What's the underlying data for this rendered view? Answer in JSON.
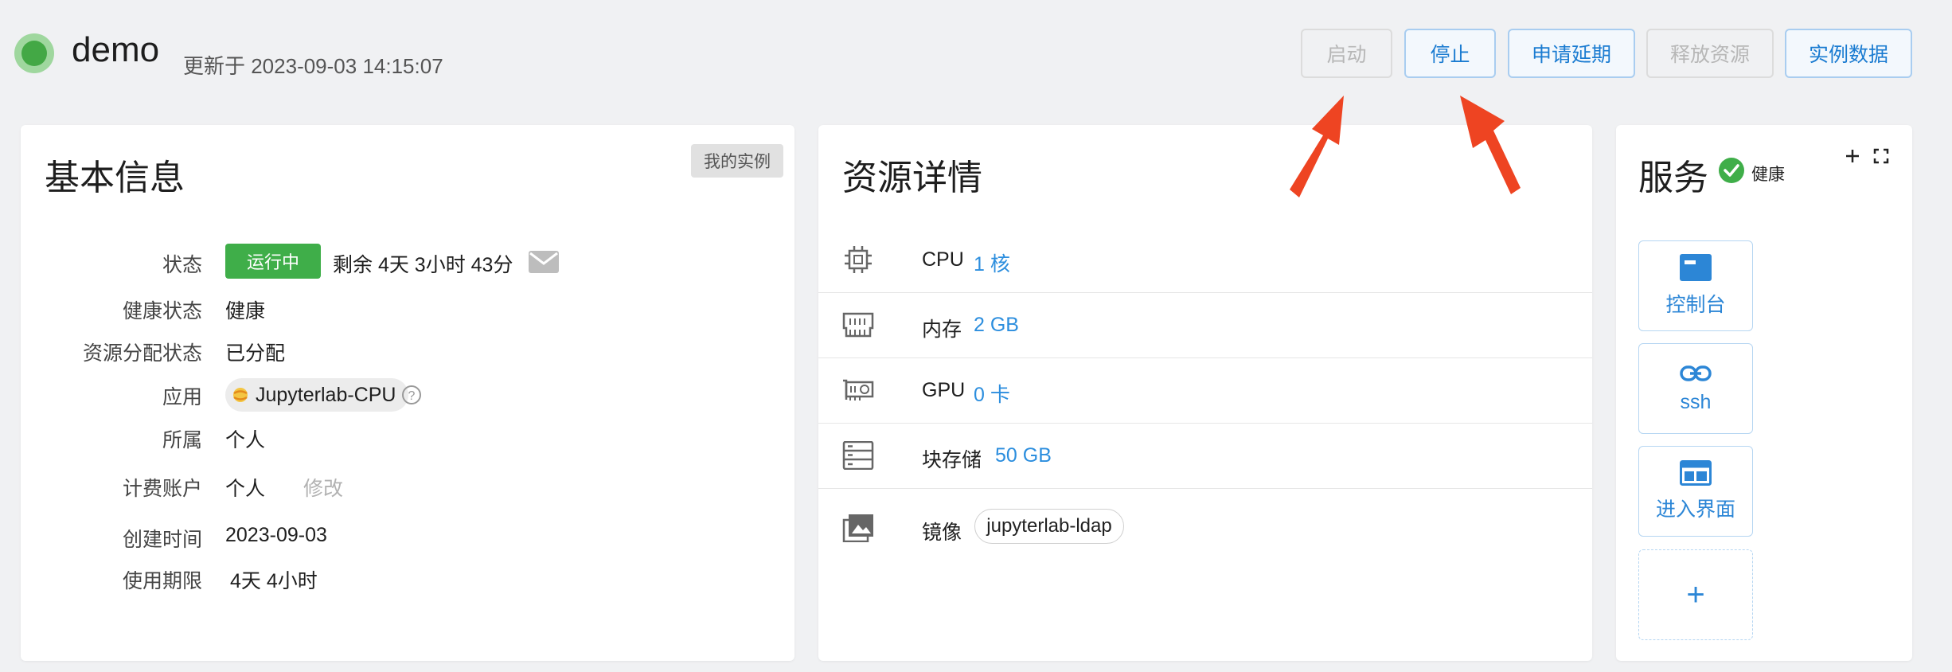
{
  "header": {
    "title": "demo",
    "updated_text": "更新于 2023-09-03 14:15:07",
    "buttons": {
      "start": "启动",
      "stop": "停止",
      "extend": "申请延期",
      "release": "释放资源",
      "instance_data": "实例数据"
    }
  },
  "basic": {
    "title": "基本信息",
    "tag": "我的实例",
    "rows": {
      "status_label": "状态",
      "status_badge": "运行中",
      "remaining": "剩余 4天 3小时 43分",
      "health_label": "健康状态",
      "health_value": "健康",
      "alloc_label": "资源分配状态",
      "alloc_value": "已分配",
      "app_label": "应用",
      "app_value": "Jupyterlab-CPU",
      "owner_label": "所属",
      "owner_value": "个人",
      "billing_label": "计费账户",
      "billing_value": "个人",
      "billing_edit": "修改",
      "created_label": "创建时间",
      "created_value": "2023-09-03",
      "period_label": "使用期限",
      "period_value": "4天 4小时"
    }
  },
  "resources": {
    "title": "资源详情",
    "cpu_label": "CPU",
    "cpu_value": "1 核",
    "mem_label": "内存",
    "mem_value": "2 GB",
    "gpu_label": "GPU",
    "gpu_value": "0 卡",
    "disk_label": "块存储",
    "disk_value": "50 GB",
    "image_label": "镜像",
    "image_value": "jupyterlab-ldap"
  },
  "services": {
    "title": "服务",
    "health": "健康",
    "items": [
      "控制台",
      "ssh",
      "进入界面"
    ],
    "add": "+"
  },
  "colors": {
    "running": "#3fae49",
    "accent": "#1a7bd1",
    "arrow": "#ee4422"
  }
}
